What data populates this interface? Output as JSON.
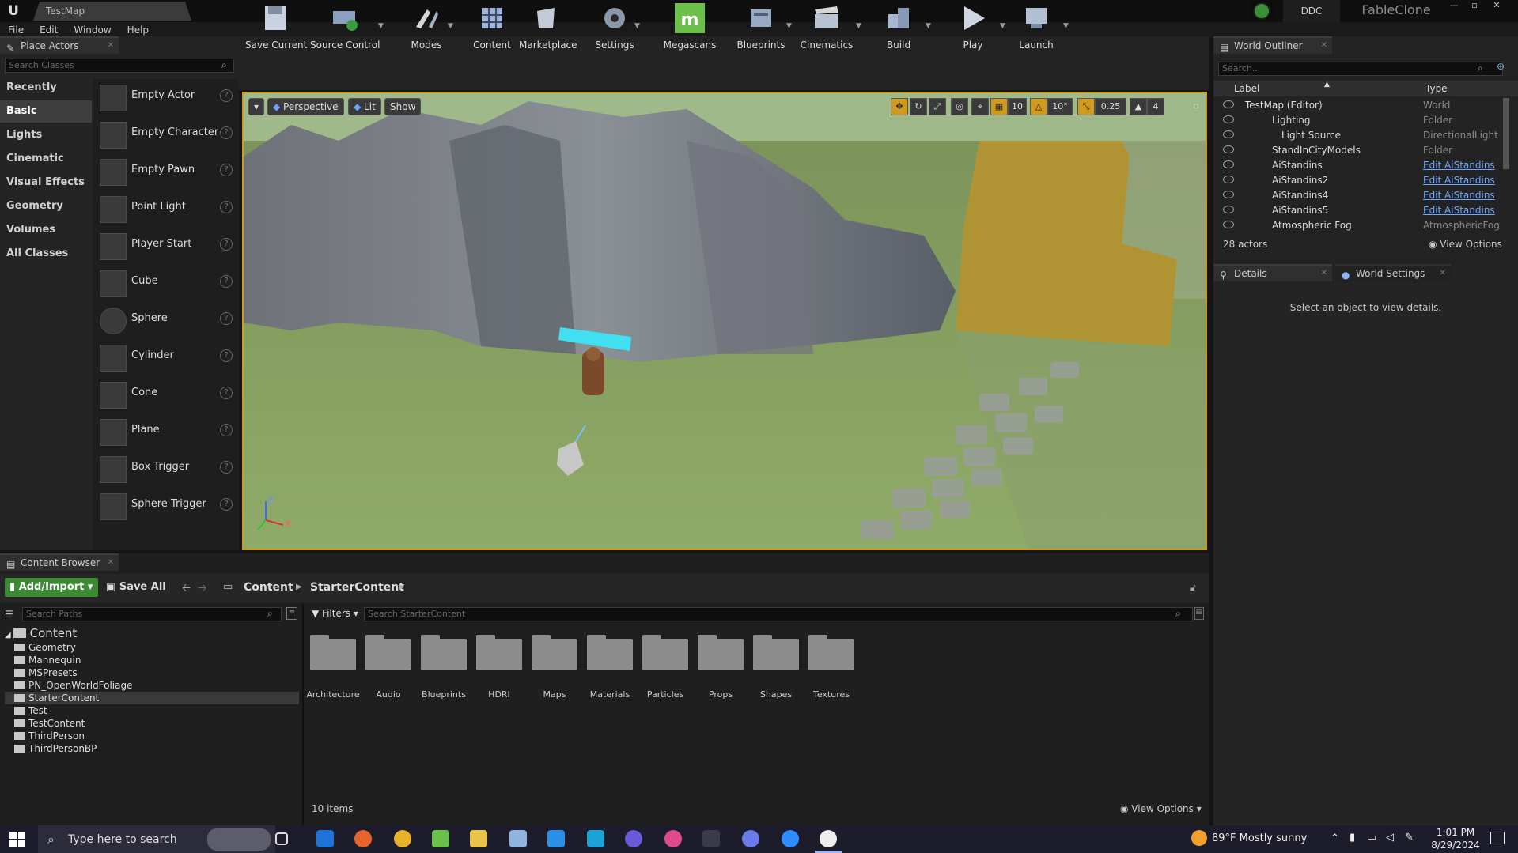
{
  "window": {
    "tab": "TestMap",
    "ddc": "DDC",
    "project": "FableClone",
    "minimize": "—",
    "maximize": "▫",
    "close": "✕"
  },
  "menu": [
    "File",
    "Edit",
    "Window",
    "Help"
  ],
  "place_actors": {
    "tab": "Place Actors",
    "search_placeholder": "Search Classes",
    "categories": [
      "Recently Placed",
      "Basic",
      "Lights",
      "Cinematic",
      "Visual Effects",
      "Geometry",
      "Volumes",
      "All Classes"
    ],
    "actors": [
      "Empty Actor",
      "Empty Character",
      "Empty Pawn",
      "Point Light",
      "Player Start",
      "Cube",
      "Sphere",
      "Cylinder",
      "Cone",
      "Plane",
      "Box Trigger",
      "Sphere Trigger"
    ]
  },
  "toolbar": [
    "Save Current",
    "Source Control",
    "Modes",
    "Content",
    "Marketplace",
    "Settings",
    "Megascans",
    "Blueprints",
    "Cinematics",
    "Build",
    "Play",
    "Launch"
  ],
  "viewport": {
    "perspective": "Perspective",
    "lit": "Lit",
    "show": "Show",
    "grid_snap": "10",
    "rot_snap": "10°",
    "scale_snap": "0.25",
    "cam_speed": "4",
    "axis_z": "Z",
    "axis_x": "X"
  },
  "outliner": {
    "tab": "World Outliner",
    "search_placeholder": "Search...",
    "col_label": "Label",
    "col_type": "Type",
    "rows": [
      {
        "label": "TestMap (Editor)",
        "type": "World"
      },
      {
        "label": "Lighting",
        "type": "Folder"
      },
      {
        "label": "Light Source",
        "type": "DirectionalLight"
      },
      {
        "label": "StandInCityModels",
        "type": "Folder"
      },
      {
        "label": "AiStandins",
        "type": "Edit AiStandins"
      },
      {
        "label": "AiStandins2",
        "type": "Edit AiStandins"
      },
      {
        "label": "AiStandins4",
        "type": "Edit AiStandins"
      },
      {
        "label": "AiStandins5",
        "type": "Edit AiStandins"
      },
      {
        "label": "Atmospheric Fog",
        "type": "AtmosphericFog"
      }
    ],
    "count": "28 actors",
    "view_options": "View Options"
  },
  "details": {
    "tab": "Details",
    "tab2": "World Settings",
    "empty": "Select an object to view details."
  },
  "content_browser": {
    "tab": "Content Browser",
    "add_import": "Add/Import",
    "save_all": "Save All",
    "path": [
      "Content",
      "StarterContent"
    ],
    "search_paths": "Search Paths",
    "filters": "Filters",
    "search_placeholder": "Search StarterContent",
    "tree": [
      "Content",
      "Geometry",
      "Mannequin",
      "MSPresets",
      "PN_OpenWorldFoliage",
      "StarterContent",
      "Test",
      "TestContent",
      "ThirdPerson",
      "ThirdPersonBP"
    ],
    "folders": [
      "Architecture",
      "Audio",
      "Blueprints",
      "HDRI",
      "Maps",
      "Materials",
      "Particles",
      "Props",
      "Shapes",
      "Textures"
    ],
    "count": "10 items",
    "view_options": "View Options"
  },
  "taskbar": {
    "search": "Type here to search",
    "weather": "89°F  Mostly sunny",
    "time": "1:01 PM",
    "date": "8/29/2024"
  },
  "colors": {
    "accent": "#d09a1c",
    "link": "#6ea7ff",
    "megascans": "#6cc04a"
  }
}
